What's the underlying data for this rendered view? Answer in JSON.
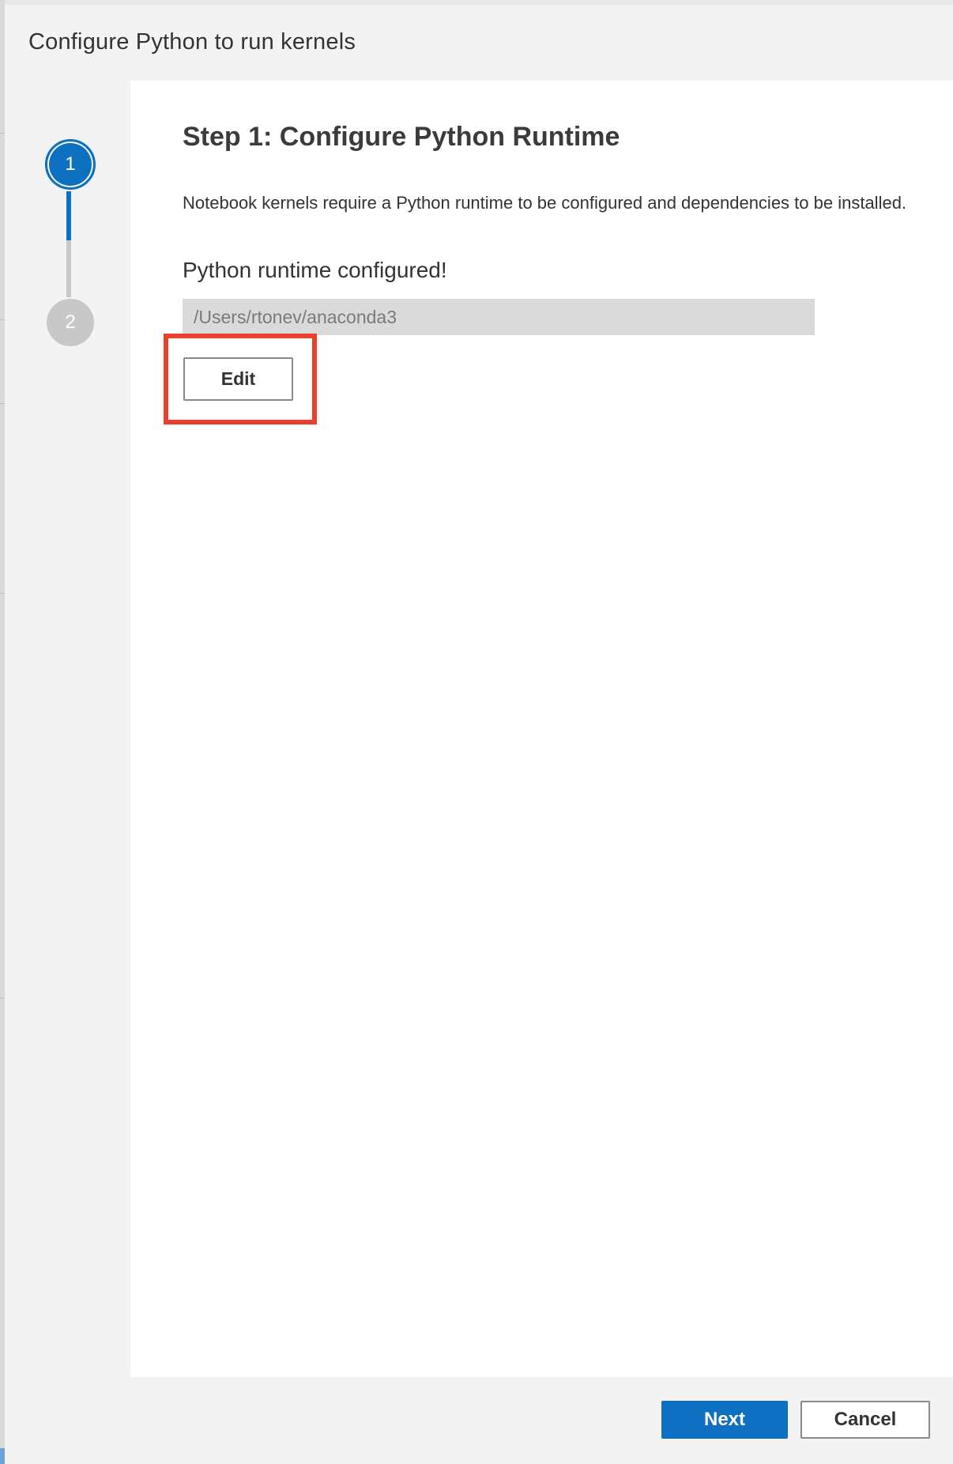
{
  "dialog": {
    "title": "Configure Python to run kernels"
  },
  "stepper": {
    "steps": [
      {
        "number": "1",
        "state": "active"
      },
      {
        "number": "2",
        "state": "inactive"
      }
    ]
  },
  "step1": {
    "heading": "Step 1: Configure Python Runtime",
    "description": "Notebook kernels require a Python runtime to be configured and dependencies to be installed.",
    "status": "Python runtime configured!",
    "runtime_path": "/Users/rtonev/anaconda3",
    "edit_label": "Edit"
  },
  "footer": {
    "next_label": "Next",
    "cancel_label": "Cancel"
  },
  "colors": {
    "accent": "#0e70c0",
    "highlight": "#e8402d",
    "inactive_step": "#c8c8c8"
  }
}
